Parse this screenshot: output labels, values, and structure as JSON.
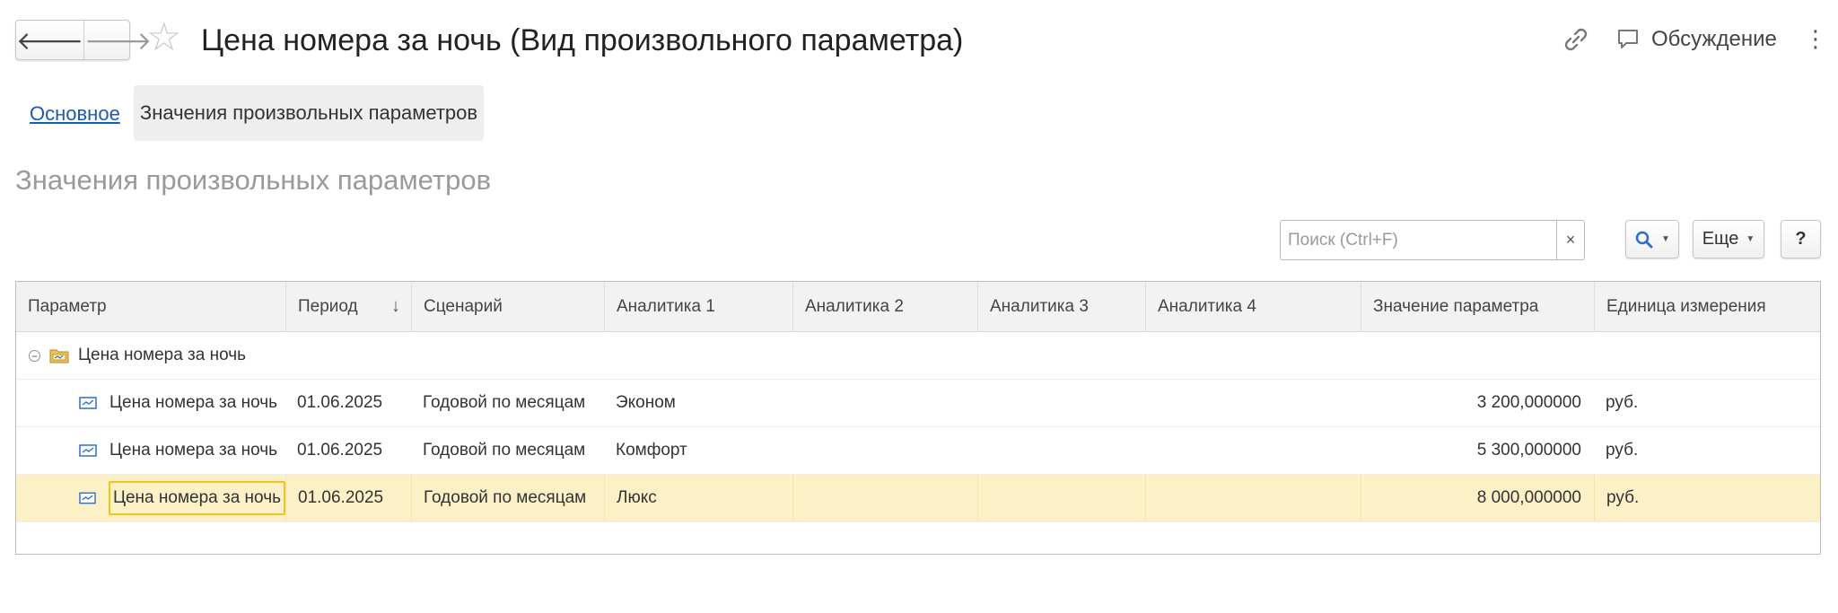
{
  "window": {
    "title": "Цена номера за ночь (Вид произвольного параметра)",
    "discussion_label": "Обсуждение",
    "icons": [
      "arrow-left-icon",
      "arrow-right-icon",
      "star-icon",
      "link-icon",
      "chat-icon",
      "more-vertical-icon"
    ]
  },
  "tabs": [
    {
      "label": "Основное",
      "active": false
    },
    {
      "label": "Значения произвольных параметров",
      "active": true
    }
  ],
  "section_title": "Значения произвольных параметров",
  "toolbar": {
    "search_placeholder": "Поиск (Ctrl+F)",
    "search_value": "",
    "clear_symbol": "×",
    "more_label": "Еще",
    "help_label": "?"
  },
  "table": {
    "columns": [
      "Параметр",
      "Период",
      "Сценарий",
      "Аналитика 1",
      "Аналитика 2",
      "Аналитика 3",
      "Аналитика 4",
      "Значение параметра",
      "Единица измерения"
    ],
    "sort_indicator": "↓",
    "group": {
      "label": "Цена номера за ночь",
      "expanded": true
    },
    "rows": [
      {
        "param": "Цена номера за ночь",
        "period": "01.06.2025",
        "scenario": "Годовой по месяцам",
        "a1": "Эконом",
        "a2": "",
        "a3": "",
        "a4": "",
        "value": "3 200,000000",
        "unit": "руб.",
        "selected": false
      },
      {
        "param": "Цена номера за ночь",
        "period": "01.06.2025",
        "scenario": "Годовой по месяцам",
        "a1": "Комфорт",
        "a2": "",
        "a3": "",
        "a4": "",
        "value": "5 300,000000",
        "unit": "руб.",
        "selected": false
      },
      {
        "param": "Цена номера за ночь",
        "period": "01.06.2025",
        "scenario": "Годовой по месяцам",
        "a1": "Люкс",
        "a2": "",
        "a3": "",
        "a4": "",
        "value": "8 000,000000",
        "unit": "руб.",
        "selected": true
      }
    ]
  },
  "colors": {
    "accent_link": "#1a5ab5",
    "selected_row": "#fbf0c6",
    "focus_border": "#f0c419",
    "search_icon": "#2f6fc8"
  }
}
